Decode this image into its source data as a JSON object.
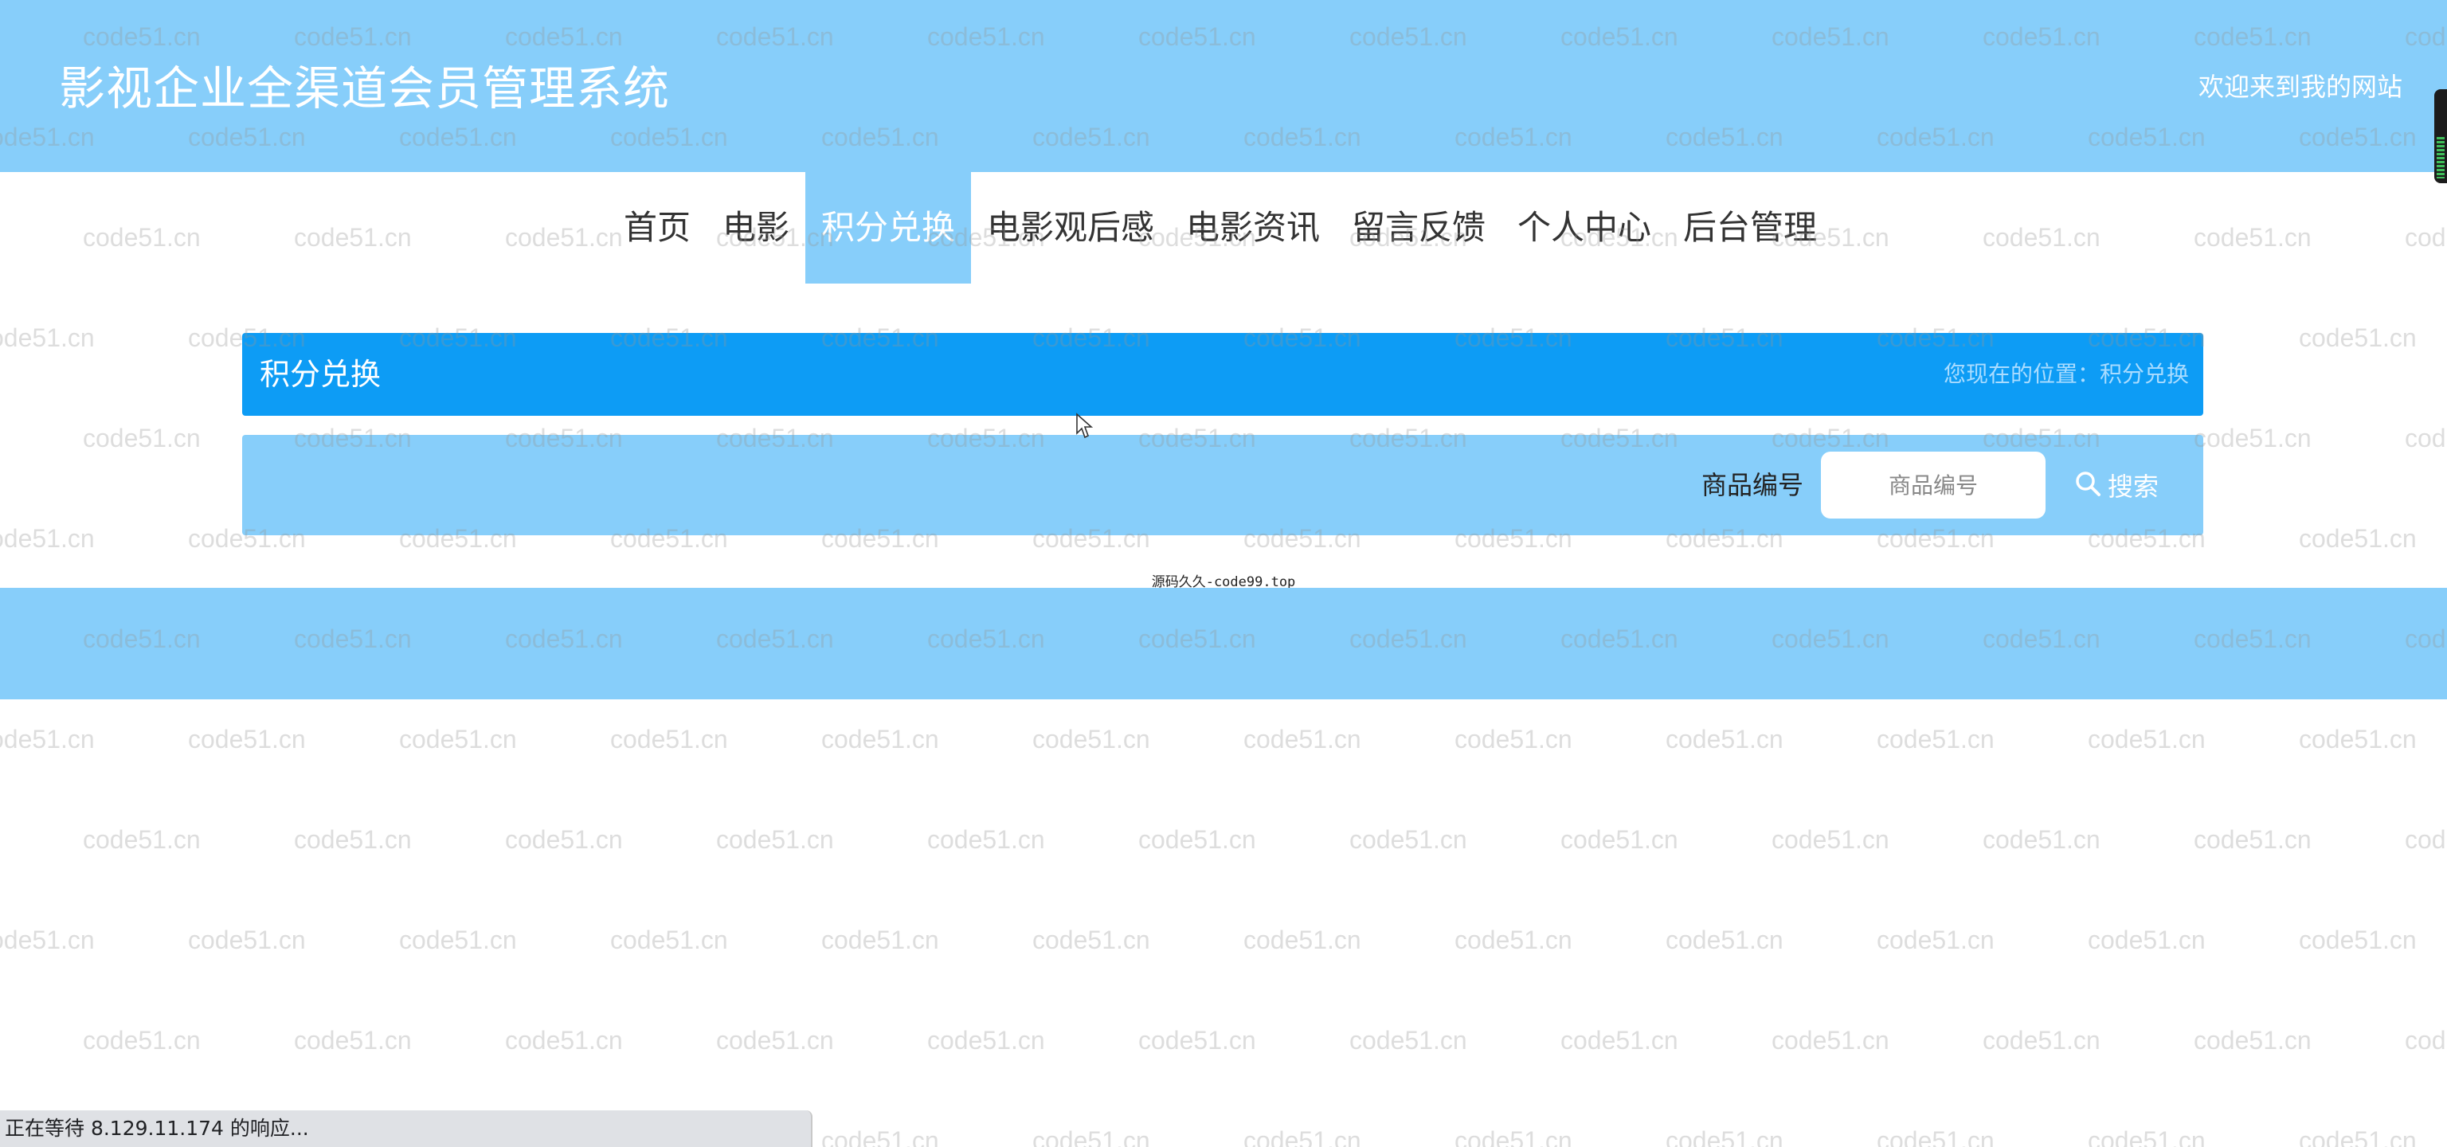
{
  "header": {
    "site_title": "影视企业全渠道会员管理系统",
    "welcome": "欢迎来到我的网站"
  },
  "nav": {
    "items": [
      {
        "label": "首页",
        "active": false
      },
      {
        "label": "电影",
        "active": false
      },
      {
        "label": "积分兑换",
        "active": true
      },
      {
        "label": "电影观后感",
        "active": false
      },
      {
        "label": "电影资讯",
        "active": false
      },
      {
        "label": "留言反馈",
        "active": false
      },
      {
        "label": "个人中心",
        "active": false
      },
      {
        "label": "后台管理",
        "active": false
      }
    ]
  },
  "banner": {
    "title": "积分兑换",
    "breadcrumb": "您现在的位置：积分兑换"
  },
  "search": {
    "label": "商品编号",
    "placeholder": "商品编号",
    "value": "",
    "button_label": "搜索",
    "button_icon": "search-icon"
  },
  "footer": {
    "note": "源码久久-code99.top"
  },
  "watermark": {
    "text": "code51.cn"
  },
  "status_bar": {
    "text": "正在等待 8.129.11.174 的响应..."
  },
  "colors": {
    "primary_light": "#87cefa",
    "primary": "#0d9cf5",
    "white": "#ffffff"
  }
}
